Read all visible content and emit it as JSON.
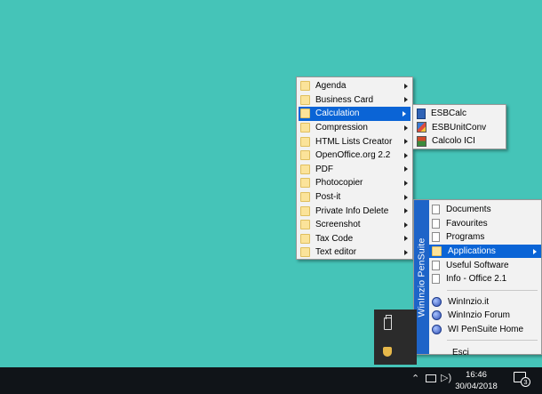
{
  "main_menu": {
    "items": [
      {
        "label": "Agenda"
      },
      {
        "label": "Business Card"
      },
      {
        "label": "Calculation"
      },
      {
        "label": "Compression"
      },
      {
        "label": "HTML Lists Creator"
      },
      {
        "label": "OpenOffice.org 2.2"
      },
      {
        "label": "PDF"
      },
      {
        "label": "Photocopier"
      },
      {
        "label": "Post-it"
      },
      {
        "label": "Private Info Delete"
      },
      {
        "label": "Screenshot"
      },
      {
        "label": "Tax Code"
      },
      {
        "label": "Text editor"
      }
    ]
  },
  "calculation_submenu": {
    "items": [
      {
        "label": "ESBCalc"
      },
      {
        "label": "ESBUnitConv"
      },
      {
        "label": "Calcolo ICI"
      }
    ]
  },
  "wininzio_menu": {
    "band_label": "WinInzio PenSuite",
    "items": [
      {
        "label": "Documents"
      },
      {
        "label": "Favourites"
      },
      {
        "label": "Programs"
      },
      {
        "label": "Applications"
      },
      {
        "label": "Useful Software"
      },
      {
        "label": "Info - Office 2.1"
      },
      {
        "label": "WinInzio.it"
      },
      {
        "label": "WinInzio Forum"
      },
      {
        "label": "WI PenSuite Home"
      },
      {
        "label": "Esci"
      }
    ]
  },
  "taskbar": {
    "time": "16:46",
    "date": "30/04/2018",
    "notification_count": "3"
  },
  "colors": {
    "desktop": "#45c4b8",
    "selection": "#0a64d6",
    "band": "#1e64c8",
    "taskbar": "#101418"
  }
}
